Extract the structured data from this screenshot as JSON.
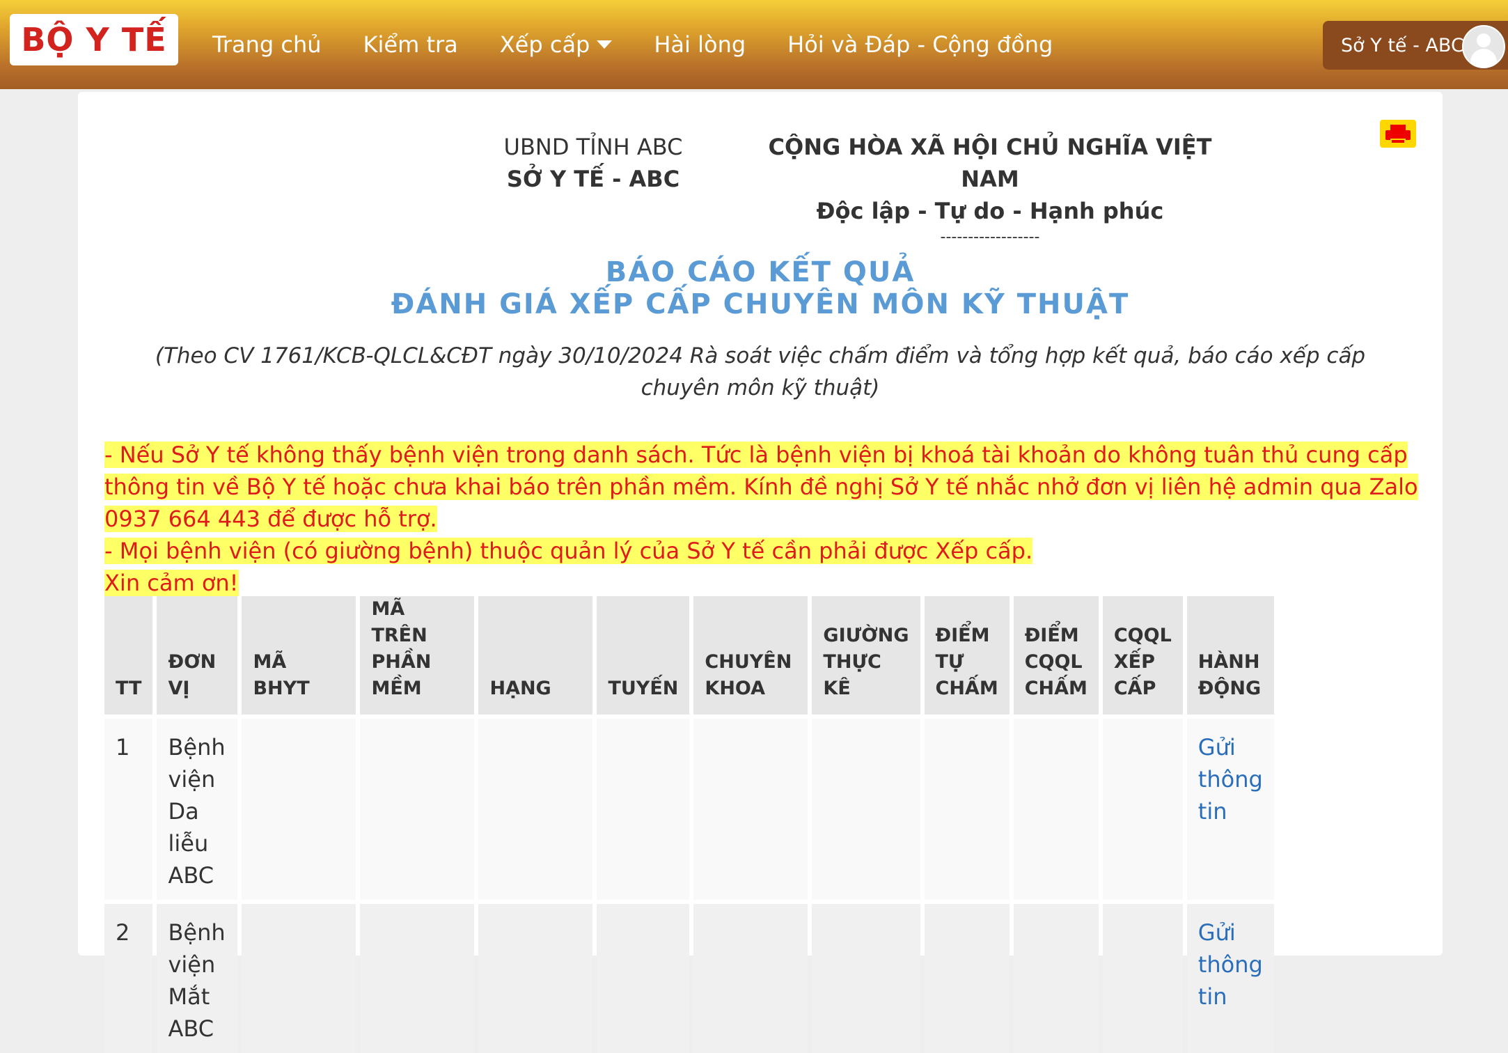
{
  "navbar": {
    "logo_text": "BỘ Y TẾ",
    "items": [
      {
        "label": "Trang chủ"
      },
      {
        "label": "Kiểm tra"
      },
      {
        "label": "Xếp cấp",
        "dropdown": true
      },
      {
        "label": "Hài lòng"
      },
      {
        "label": "Hỏi và Đáp - Cộng đồng"
      }
    ],
    "user_name": "Sở Y tế - ABC"
  },
  "header": {
    "left_line1": "UBND TỈNH ABC",
    "left_line2": "SỞ Y TẾ - ABC",
    "right_line1": "CỘNG HÒA XÃ HỘI CHỦ NGHĨA VIỆT NAM",
    "right_line2": "Độc lập - Tự do - Hạnh phúc",
    "dashes": "------------------"
  },
  "report": {
    "title_line1": "BÁO CÁO KẾT QUẢ",
    "title_line2": "ĐÁNH GIÁ XẾP CẤP CHUYÊN MÔN KỸ THUẬT",
    "subtitle": "(Theo CV 1761/KCB-QLCL&CĐT ngày 30/10/2024 Rà soát việc chấm điểm và tổng hợp kết quả, báo cáo xếp cấp chuyên môn kỹ thuật)"
  },
  "notice": {
    "line1": "- Nếu Sở Y tế không thấy bệnh viện trong danh sách. Tức là bệnh viện bị khoá tài khoản do không tuân thủ cung cấp thông tin về Bộ Y tế hoặc chưa khai báo trên phần mềm. Kính đề nghị Sở Y tế nhắc nhở đơn vị liên hệ admin qua Zalo 0937 664 443 để được hỗ trợ.",
    "line2": "- Mọi bệnh viện (có giường bệnh) thuộc quản lý của Sở Y tế cần phải được Xếp cấp.",
    "line3": "Xin cảm ơn!"
  },
  "table": {
    "headers": [
      "TT",
      "ĐƠN VỊ",
      "MÃ BHYT",
      "MÃ TRÊN PHẦN MỀM",
      "HẠNG",
      "TUYẾN",
      "CHUYÊN KHOA",
      "GIƯỜNG THỰC KÊ",
      "ĐIỂM TỰ CHẤM",
      "ĐIỂM CQQL CHẤM",
      "CQQL XẾP CẤP",
      "HÀNH ĐỘNG"
    ],
    "rows": [
      {
        "tt": "1",
        "don_vi": "Bệnh viện Da liễu ABC",
        "ma_bhyt": "",
        "ma_pm": "",
        "hang": "",
        "tuyen": "",
        "chuyen_khoa": "",
        "giuong": "",
        "diem_tu_cham": "",
        "diem_cqql": "",
        "cqql_xep_cap": "",
        "action": "Gửi thông tin"
      },
      {
        "tt": "2",
        "don_vi": "Bệnh viện Mắt ABC",
        "ma_bhyt": "",
        "ma_pm": "",
        "hang": "",
        "tuyen": "",
        "chuyen_khoa": "",
        "giuong": "",
        "diem_tu_cham": "",
        "diem_cqql": "",
        "cqql_xep_cap": "",
        "action": "Gửi thông tin"
      }
    ]
  }
}
